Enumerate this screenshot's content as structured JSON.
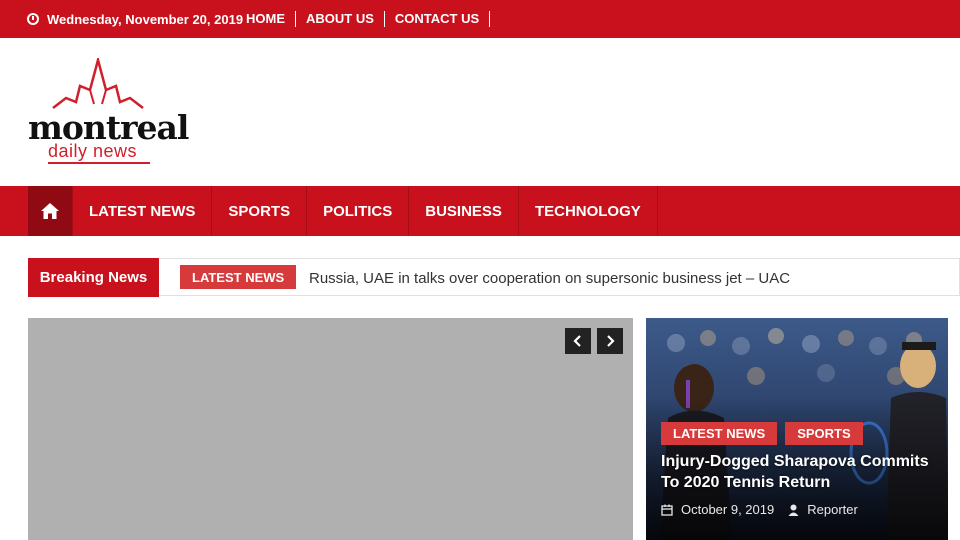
{
  "topbar": {
    "date": "Wednesday, November 20, 2019",
    "links": [
      "HOME",
      "ABOUT US",
      "CONTACT US"
    ]
  },
  "logo": {
    "brand": "montreal",
    "sub": "daily news"
  },
  "nav": {
    "items": [
      "LATEST NEWS",
      "SPORTS",
      "POLITICS",
      "BUSINESS",
      "TECHNOLOGY"
    ]
  },
  "breaking": {
    "label": "Breaking News",
    "tag": "LATEST NEWS",
    "headline": "Russia, UAE in talks over cooperation on supersonic business jet – UAC"
  },
  "feature": {
    "tags": [
      "LATEST NEWS",
      "SPORTS"
    ],
    "title": "Injury-Dogged Sharapova Commits To 2020 Tennis Return",
    "date": "October 9, 2019",
    "author": "Reporter"
  },
  "colors": {
    "brand_red": "#c8111d",
    "tag_red": "#d63a3a",
    "slider_gray": "#b0b0b0"
  }
}
